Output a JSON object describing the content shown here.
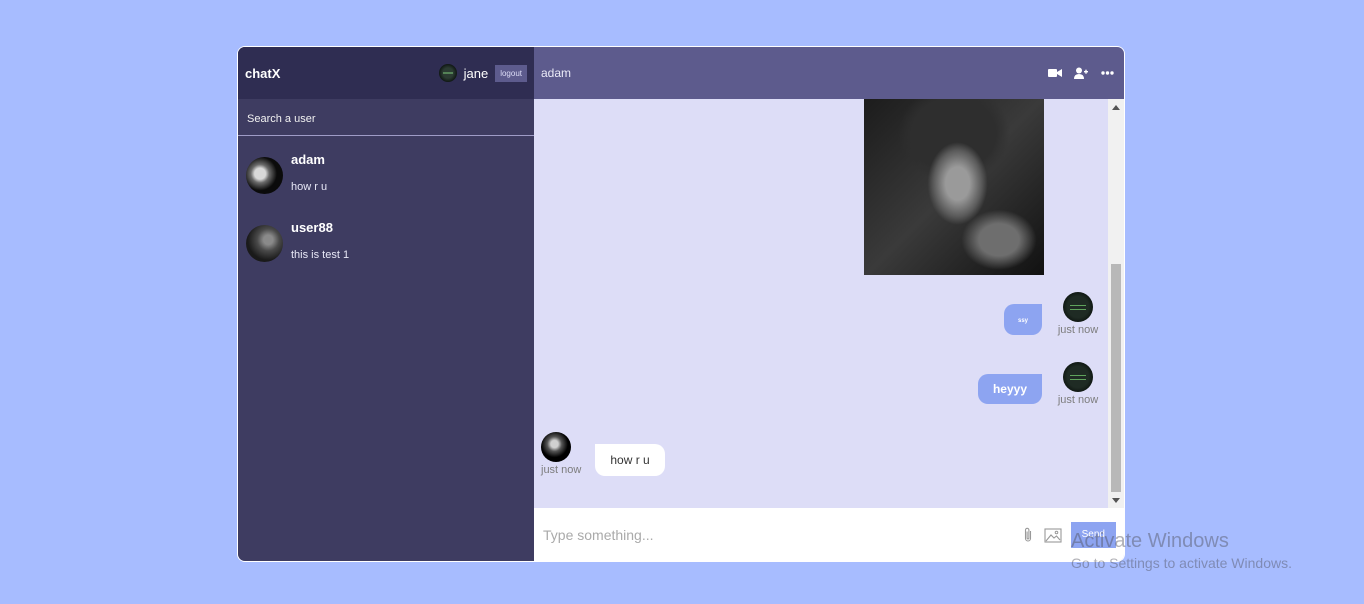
{
  "sidebar": {
    "logo": "chatX",
    "current_user": "jane",
    "logout_label": "logout",
    "search_placeholder": "Search a user",
    "chats": [
      {
        "name": "adam",
        "last_message": "how r u"
      },
      {
        "name": "user88",
        "last_message": "this is test 1"
      }
    ]
  },
  "chat": {
    "title": "adam",
    "messages": [
      {
        "owner": true,
        "text": "ssy",
        "time": "just now"
      },
      {
        "owner": true,
        "text": "heyyy",
        "time": "just now"
      },
      {
        "owner": false,
        "text": "how r u",
        "time": "just now"
      }
    ]
  },
  "input": {
    "placeholder": "Type something...",
    "send_label": "Send"
  },
  "watermark": {
    "title": "Activate Windows",
    "subtitle": "Go to Settings to activate Windows."
  },
  "colors": {
    "background": "#a7bcff",
    "sidebar": "#3e3c61",
    "navbar": "#2f2d52",
    "chat_header": "#5d5b8d",
    "chat_bg": "#ddddf7",
    "own_bubble": "#8da4f1"
  },
  "icons": [
    "video-camera-icon",
    "add-user-icon",
    "more-icon",
    "attach-icon",
    "image-icon"
  ]
}
